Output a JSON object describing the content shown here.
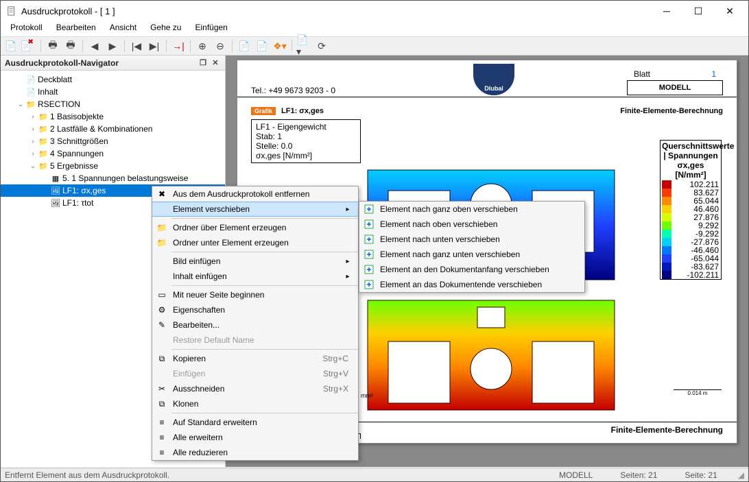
{
  "window": {
    "title": "Ausdruckprotokoll - [ 1 ]"
  },
  "menu": [
    "Protokoll",
    "Bearbeiten",
    "Ansicht",
    "Gehe zu",
    "Einfügen"
  ],
  "navigator": {
    "title": "Ausdruckprotokoll-Navigator",
    "items": [
      {
        "label": "Deckblatt",
        "indent": 1,
        "icon": "doc"
      },
      {
        "label": "Inhalt",
        "indent": 1,
        "icon": "doc"
      },
      {
        "label": "RSECTION",
        "indent": 1,
        "icon": "folder",
        "exp": "v"
      },
      {
        "label": "1 Basisobjekte",
        "indent": 2,
        "icon": "folder",
        "exp": ">"
      },
      {
        "label": "2 Lastfälle & Kombinationen",
        "indent": 2,
        "icon": "folder",
        "exp": ">"
      },
      {
        "label": "3 Schnittgrößen",
        "indent": 2,
        "icon": "folder",
        "exp": ">"
      },
      {
        "label": "4 Spannungen",
        "indent": 2,
        "icon": "folder",
        "exp": ">"
      },
      {
        "label": "5 Ergebnisse",
        "indent": 2,
        "icon": "folder",
        "exp": "v"
      },
      {
        "label": "5. 1 Spannungen belastungsweise",
        "indent": 3,
        "icon": "grid"
      },
      {
        "label": "LF1: σx,ges",
        "indent": 3,
        "icon": "img",
        "sel": true
      },
      {
        "label": "LF1: τtot",
        "indent": 3,
        "icon": "img"
      }
    ]
  },
  "context_menu": {
    "items": [
      {
        "label": "Aus dem Ausdruckprotokoll entfernen",
        "icon": "✖"
      },
      {
        "label": "Element verschieben",
        "hl": true,
        "sub": true
      },
      {
        "sep": true
      },
      {
        "label": "Ordner über Element erzeugen",
        "icon": "📁"
      },
      {
        "label": "Ordner unter Element erzeugen",
        "icon": "📁"
      },
      {
        "sep": true
      },
      {
        "label": "Bild einfügen",
        "sub": true
      },
      {
        "label": "Inhalt einfügen",
        "sub": true
      },
      {
        "sep": true
      },
      {
        "label": "Mit neuer Seite beginnen",
        "icon": "▭"
      },
      {
        "label": "Eigenschaften",
        "icon": "⚙"
      },
      {
        "label": "Bearbeiten...",
        "icon": "✎"
      },
      {
        "label": "Restore Default Name",
        "dis": true
      },
      {
        "sep": true
      },
      {
        "label": "Kopieren",
        "sc": "Strg+C",
        "icon": "⧉"
      },
      {
        "label": "Einfügen",
        "sc": "Strg+V",
        "dis": true
      },
      {
        "label": "Ausschneiden",
        "sc": "Strg+X",
        "icon": "✂"
      },
      {
        "label": "Klonen",
        "icon": "⧉"
      },
      {
        "sep": true
      },
      {
        "label": "Auf Standard erweitern",
        "icon": "≡"
      },
      {
        "label": "Alle erweitern",
        "icon": "≡"
      },
      {
        "label": "Alle reduzieren",
        "icon": "≡"
      }
    ]
  },
  "submenu": {
    "items": [
      {
        "label": "Element nach ganz oben verschieben"
      },
      {
        "label": "Element nach oben verschieben"
      },
      {
        "label": "Element nach unten verschieben"
      },
      {
        "label": "Element nach ganz unten verschieben"
      },
      {
        "label": "Element an den Dokumentanfang verschieben"
      },
      {
        "label": "Element an das Dokumentende verschieben"
      }
    ]
  },
  "page": {
    "tel": "Tel.: +49 9673 9203 - 0",
    "logo": "Dlubal",
    "blatt_label": "Blatt",
    "blatt_no": "1",
    "modell": "MODELL",
    "tag": "Grafik",
    "lf": "LF1: σx,ges",
    "fe_title": "Finite-Elemente-Berechnung",
    "info_lines": [
      "LF1 - Eigengewicht",
      "Stab: 1",
      "Stelle: 0.0",
      "σx,ges [N/mm²]"
    ],
    "legend_title1": "Querschnittswerte",
    "legend_title2": "| Spannungen",
    "legend_title3": "σx,ges [N/mm²]",
    "legend_values": [
      "102.211",
      "83.627",
      "65.044",
      "46.460",
      "27.876",
      "9.292",
      "-9.292",
      "-27.876",
      "-46.460",
      "-65.044",
      "-83.627",
      "-102.211"
    ],
    "legend_colors": [
      "#c40000",
      "#ff3a00",
      "#ff8a00",
      "#ffd000",
      "#d6ff00",
      "#6bff00",
      "#00ffb0",
      "#00d0ff",
      "#007bff",
      "#2040ff",
      "#0018c0",
      "#000080"
    ],
    "scale": "0.014 m",
    "sigma_unit": "mm²"
  },
  "status": {
    "msg": "Entfernt Element aus dem Ausdruckprotokoll.",
    "modell": "MODELL",
    "seiten": "Seiten: 21",
    "seite": "Seite: 21"
  }
}
